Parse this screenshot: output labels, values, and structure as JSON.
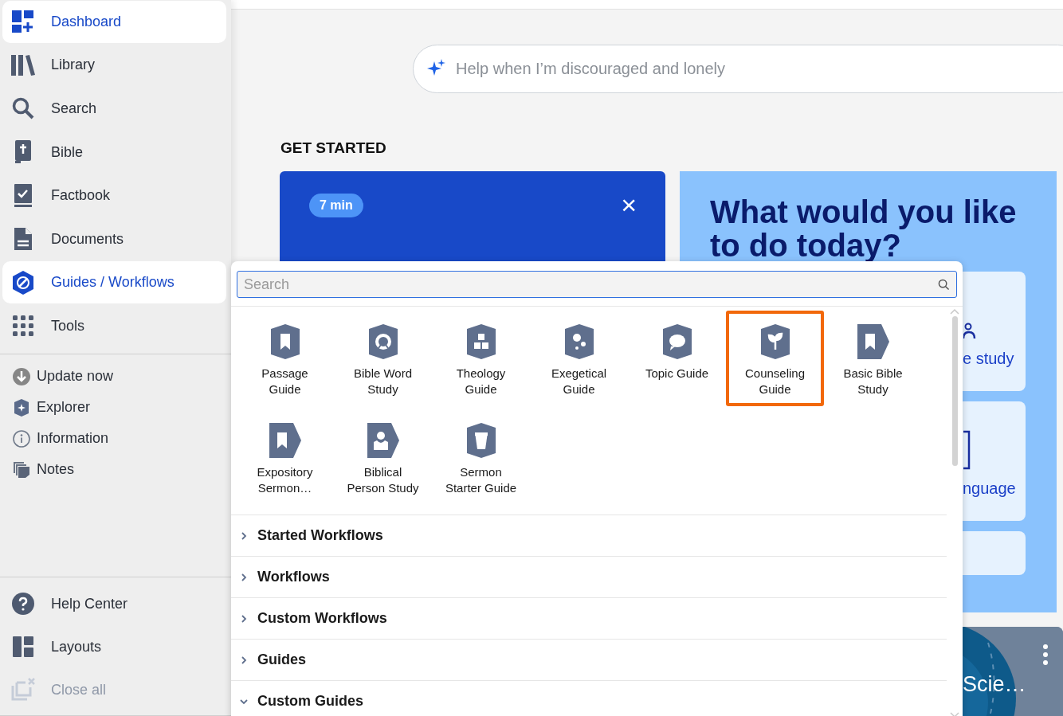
{
  "sidebar": {
    "main_items": [
      {
        "label": "Dashboard",
        "selected": true
      },
      {
        "label": "Library",
        "selected": false
      },
      {
        "label": "Search",
        "selected": false
      },
      {
        "label": "Bible",
        "selected": false
      },
      {
        "label": "Factbook",
        "selected": false
      },
      {
        "label": "Documents",
        "selected": false
      },
      {
        "label": "Guides / Workflows",
        "selected": true
      },
      {
        "label": "Tools",
        "selected": false
      }
    ],
    "secondary_items": [
      {
        "label": "Update now"
      },
      {
        "label": "Explorer"
      },
      {
        "label": "Information"
      },
      {
        "label": "Notes"
      }
    ],
    "bottom_items": [
      {
        "label": "Help Center",
        "disabled": false
      },
      {
        "label": "Layouts",
        "disabled": false
      },
      {
        "label": "Close all",
        "disabled": true
      }
    ]
  },
  "main": {
    "prompt_search": {
      "placeholder": "Help when I’m discouraged and lonely"
    },
    "section_title": "GET STARTED",
    "intro_card": {
      "badge": "7 min",
      "close": "×"
    },
    "prompt_card": {
      "title": "What would you like to do today?",
      "options": [
        {
          "text": "e study",
          "kind": "person"
        },
        {
          "text": "nguage",
          "kind": "book"
        },
        {
          "kind": "blank"
        }
      ]
    },
    "media_card": {
      "title": "Scie…"
    }
  },
  "popup": {
    "search": {
      "placeholder": "Search"
    },
    "guides": [
      {
        "label": "Passage\nGuide",
        "selected": false
      },
      {
        "label": "Bible Word\nStudy",
        "selected": false
      },
      {
        "label": "Theology\nGuide",
        "selected": false
      },
      {
        "label": "Exegetical\nGuide",
        "selected": false
      },
      {
        "label": "Topic Guide",
        "selected": false
      },
      {
        "label": "Counseling\nGuide",
        "selected": true
      },
      {
        "label": "Basic Bible\nStudy",
        "selected": false
      },
      {
        "label": "Expository\nSermon…",
        "selected": false
      },
      {
        "label": "Biblical\nPerson Study",
        "selected": false
      },
      {
        "label": "Sermon\nStarter Guide",
        "selected": false
      }
    ],
    "sections": [
      {
        "label": "Started Workflows",
        "expanded": false
      },
      {
        "label": "Workflows",
        "expanded": false
      },
      {
        "label": "Custom Workflows",
        "expanded": false
      },
      {
        "label": "Guides",
        "expanded": false
      },
      {
        "label": "Custom Guides",
        "expanded": true
      }
    ]
  }
}
